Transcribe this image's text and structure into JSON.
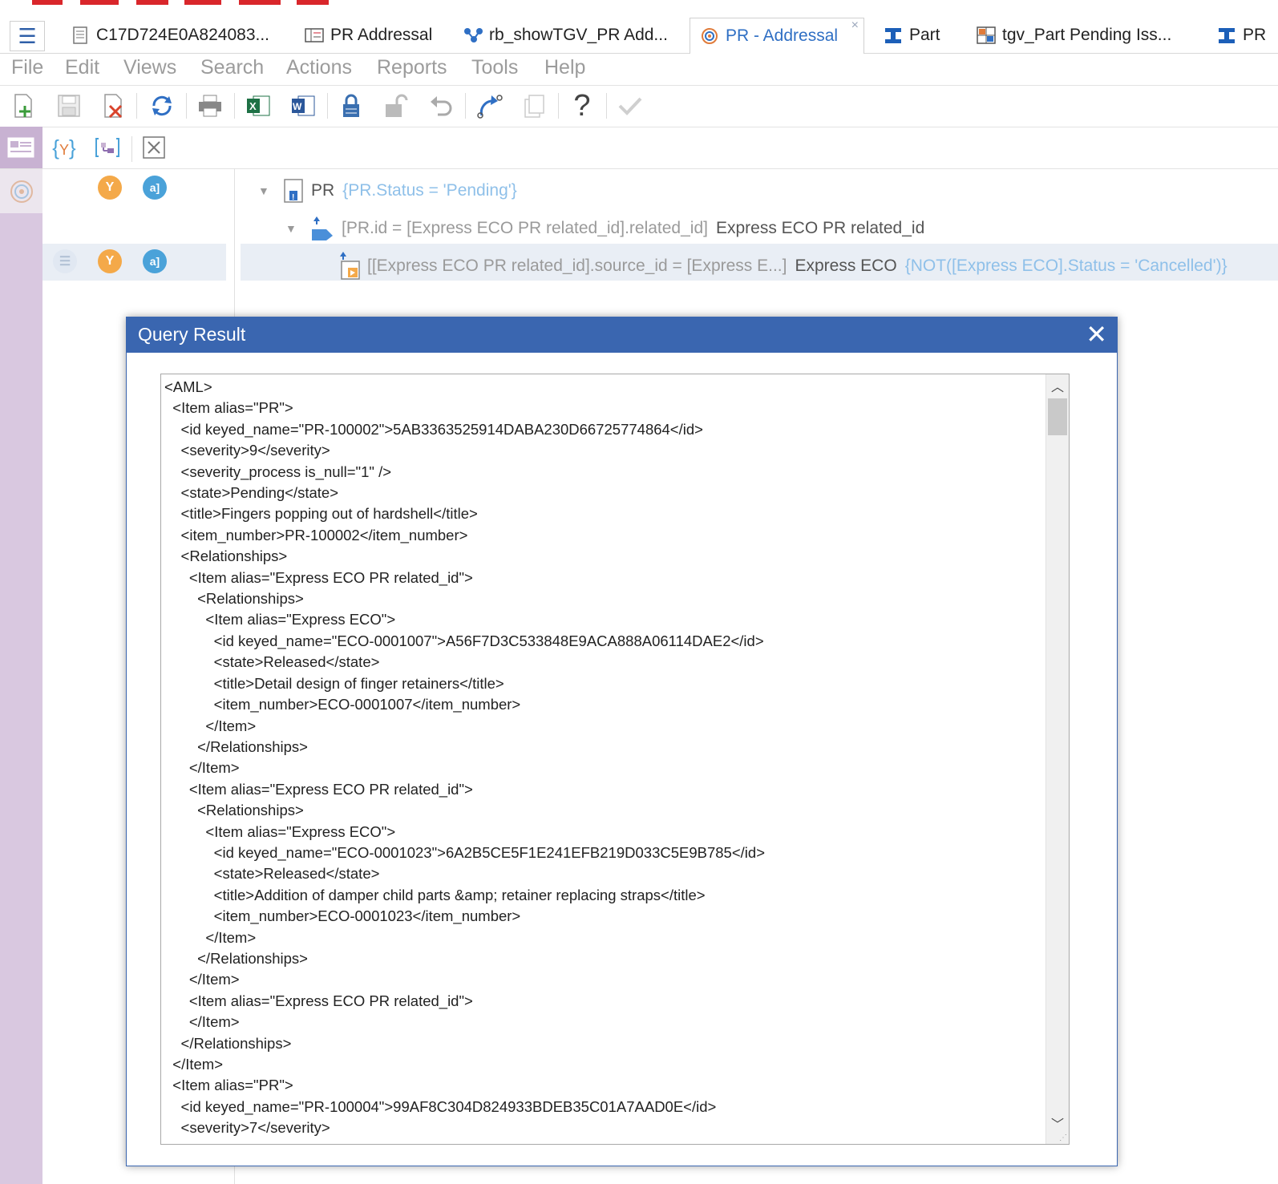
{
  "tabs": [
    {
      "label": "C17D724E0A824083...",
      "icon": "document-icon"
    },
    {
      "label": "PR Addressal",
      "icon": "form-icon"
    },
    {
      "label": "rb_showTGV_PR Add...",
      "icon": "relationship-icon"
    },
    {
      "label": "PR - Addressal",
      "icon": "query-icon",
      "active": true,
      "close": "×"
    },
    {
      "label": "Part",
      "icon": "part-icon"
    },
    {
      "label": "tgv_Part Pending Iss...",
      "icon": "tree-grid-icon"
    },
    {
      "label": "PR",
      "icon": "part-icon"
    }
  ],
  "menu": [
    "File",
    "Edit",
    "Views",
    "Search",
    "Actions",
    "Reports",
    "Tools",
    "Help"
  ],
  "toolbar_icons": [
    "new-icon",
    "save-icon",
    "delete-icon",
    "refresh-icon",
    "print-icon",
    "excel-icon",
    "word-icon",
    "lock-icon",
    "unlock-icon",
    "undo-icon",
    "redo-icon",
    "copy-icon",
    "help-icon",
    "check-icon"
  ],
  "toolbar2_icons": [
    "properties-icon",
    "where-clause-icon",
    "parameters-icon",
    "xml-icon"
  ],
  "tree": {
    "row1": {
      "label": "PR",
      "condition": "{PR.Status = 'Pending'}"
    },
    "row2": {
      "join": "[PR.id = [Express ECO PR related_id].related_id]",
      "label": "Express ECO PR related_id"
    },
    "row3": {
      "join": "[[Express ECO PR related_id].source_id = [Express E...]",
      "label": "Express ECO",
      "condition": "{NOT([Express ECO].Status = 'Cancelled')}"
    }
  },
  "dialog": {
    "title": "Query Result",
    "close_glyph": "✕",
    "lines": [
      "<AML>",
      "  <Item alias=\"PR\">",
      "    <id keyed_name=\"PR-100002\">5AB3363525914DABA230D66725774864</id>",
      "    <severity>9</severity>",
      "    <severity_process is_null=\"1\" />",
      "    <state>Pending</state>",
      "    <title>Fingers popping out of hardshell</title>",
      "    <item_number>PR-100002</item_number>",
      "    <Relationships>",
      "      <Item alias=\"Express ECO PR related_id\">",
      "        <Relationships>",
      "          <Item alias=\"Express ECO\">",
      "            <id keyed_name=\"ECO-0001007\">A56F7D3C533848E9ACA888A06114DAE2</id>",
      "            <state>Released</state>",
      "            <title>Detail design of finger retainers</title>",
      "            <item_number>ECO-0001007</item_number>",
      "          </Item>",
      "        </Relationships>",
      "      </Item>",
      "      <Item alias=\"Express ECO PR related_id\">",
      "        <Relationships>",
      "          <Item alias=\"Express ECO\">",
      "            <id keyed_name=\"ECO-0001023\">6A2B5CE5F1E241EFB219D033C5E9B785</id>",
      "            <state>Released</state>",
      "            <title>Addition of damper child parts &amp; retainer replacing straps</title>",
      "            <item_number>ECO-0001023</item_number>",
      "          </Item>",
      "        </Relationships>",
      "      </Item>",
      "      <Item alias=\"Express ECO PR related_id\">",
      "      </Item>",
      "    </Relationships>",
      "  </Item>",
      "  <Item alias=\"PR\">",
      "    <id keyed_name=\"PR-100004\">99AF8C304D824933BDEB35C01A7AAD0E</id>",
      "    <severity>7</severity>"
    ]
  },
  "colors": {
    "accent": "#3a66b0",
    "side_strip": "#d9c8e0",
    "tree_condition": "#8fc0e9",
    "brand": "#d9262b"
  }
}
